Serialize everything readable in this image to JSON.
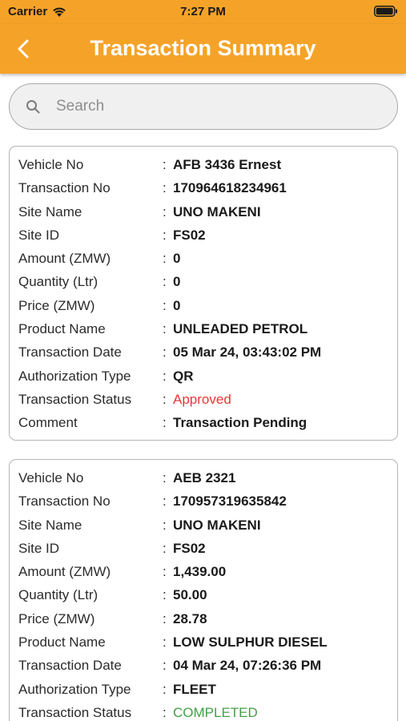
{
  "status_bar": {
    "carrier": "Carrier",
    "time": "7:27 PM"
  },
  "nav": {
    "title": "Transaction Summary",
    "back_icon": "chevron-left-icon"
  },
  "search": {
    "placeholder": "Search"
  },
  "colors": {
    "accent": "#f5a328",
    "approved": "#e53935",
    "completed": "#43a047"
  },
  "transactions": [
    {
      "fields": [
        {
          "label": "Vehicle No",
          "value": "AFB 3436 Ernest"
        },
        {
          "label": "Transaction No",
          "value": "170964618234961"
        },
        {
          "label": "Site Name",
          "value": "UNO MAKENI"
        },
        {
          "label": "Site ID",
          "value": "FS02"
        },
        {
          "label": "Amount (ZMW)",
          "value": "0"
        },
        {
          "label": "Quantity (Ltr)",
          "value": "0"
        },
        {
          "label": "Price (ZMW)",
          "value": "0"
        },
        {
          "label": "Product Name",
          "value": "UNLEADED PETROL"
        },
        {
          "label": "Transaction Date",
          "value": "05 Mar 24, 03:43:02 PM"
        },
        {
          "label": "Authorization Type",
          "value": "QR"
        },
        {
          "label": "Transaction Status",
          "value": "Approved",
          "status_color": "#e53935"
        },
        {
          "label": "Comment",
          "value": "Transaction Pending"
        }
      ]
    },
    {
      "fields": [
        {
          "label": "Vehicle No",
          "value": "AEB 2321"
        },
        {
          "label": "Transaction No",
          "value": "170957319635842"
        },
        {
          "label": "Site Name",
          "value": "UNO MAKENI"
        },
        {
          "label": "Site ID",
          "value": "FS02"
        },
        {
          "label": "Amount (ZMW)",
          "value": "1,439.00"
        },
        {
          "label": "Quantity (Ltr)",
          "value": "50.00"
        },
        {
          "label": "Price (ZMW)",
          "value": "28.78"
        },
        {
          "label": "Product Name",
          "value": "LOW SULPHUR DIESEL"
        },
        {
          "label": "Transaction Date",
          "value": "04 Mar 24, 07:26:36 PM"
        },
        {
          "label": "Authorization Type",
          "value": "FLEET"
        },
        {
          "label": "Transaction Status",
          "value": "COMPLETED",
          "status_color": "#43a047"
        }
      ]
    }
  ]
}
